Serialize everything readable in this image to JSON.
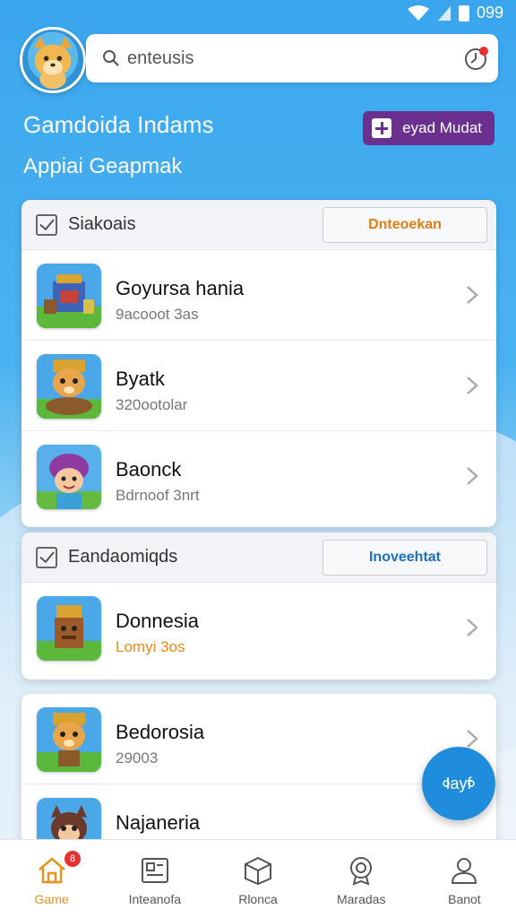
{
  "status_bar": {
    "time": "099"
  },
  "header": {
    "search_text": "enteusis"
  },
  "title_block": {
    "title": "Gamdoida Indams",
    "subtitle": "Appiai Geapmak",
    "promo_button": "eyad Mudat"
  },
  "sections": [
    {
      "title": "Siakoais",
      "action": "Dnteoekan",
      "action_color": "#e07d14",
      "items": [
        {
          "name": "Goyursa hania",
          "sub": "9acooot 3as"
        },
        {
          "name": "Byatk",
          "sub": "320ootolar"
        },
        {
          "name": "Baonck",
          "sub": "Bdrnoof 3nrt"
        }
      ]
    },
    {
      "title": "Eandaomiqds",
      "action": "Inoveehtat",
      "action_color": "#1d6fbf",
      "items": [
        {
          "name": "Donnesia",
          "sub": "Lomyi 3os"
        }
      ]
    },
    {
      "items": [
        {
          "name": "Bedorosia",
          "sub": "29003"
        },
        {
          "name": "Najaneria",
          "sub": ""
        }
      ]
    }
  ],
  "fab": {
    "label": "Iayf"
  },
  "tabbar": {
    "badge": "8",
    "tabs": [
      {
        "label": "Game",
        "icon": "home-icon"
      },
      {
        "label": "Inteanofa",
        "icon": "news-icon"
      },
      {
        "label": "Rlonca",
        "icon": "box-icon"
      },
      {
        "label": "Maradas",
        "icon": "medal-icon"
      },
      {
        "label": "Banot",
        "icon": "profile-icon"
      }
    ]
  },
  "colors": {
    "primary_blue": "#3aa6ee",
    "promo_purple": "#6b2f8f",
    "active_tab": "#e8921f",
    "fab_blue": "#1f8ddb"
  }
}
